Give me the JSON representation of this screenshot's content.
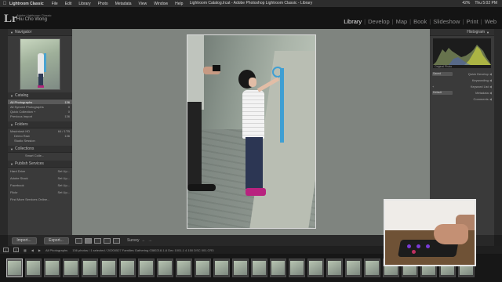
{
  "menubar": {
    "app_name": "Lightroom Classic",
    "menus": [
      "File",
      "Edit",
      "Library",
      "Photo",
      "Metadata",
      "View",
      "Window",
      "Help"
    ],
    "window_title": "Lightroom Catalog.lrcat - Adobe Photoshop Lightroom Classic - Library",
    "battery": "42%",
    "clock": "Thu 5:02 PM"
  },
  "header": {
    "logo": "Lr",
    "brand": "Adobe Lightroom Classic",
    "user": "Hiu Cho Wong",
    "modules": [
      "Library",
      "Develop",
      "Map",
      "Book",
      "Slideshow",
      "Print",
      "Web"
    ],
    "active_module": "Library"
  },
  "left_panel": {
    "navigator_label": "Navigator",
    "catalog_label": "Catalog",
    "catalog_items": [
      {
        "label": "All Photographs",
        "count": "136"
      },
      {
        "label": "All Synced Photographs",
        "count": "0"
      },
      {
        "label": "Quick Collection +",
        "count": "0"
      },
      {
        "label": "Previous Import",
        "count": "136"
      }
    ],
    "folders_label": "Folders",
    "folders": [
      {
        "label": "Macintosh HD",
        "count": "64 / 1TB"
      },
      {
        "label": "Demo Raw",
        "count": "136"
      },
      {
        "label": "Studio Session",
        "count": ""
      }
    ],
    "collections_label": "Collections",
    "collections": [
      {
        "label": "Smart Colle...",
        "count": ""
      }
    ],
    "publish_label": "Publish Services",
    "publish_items": [
      {
        "label": "Hard Drive",
        "count": "Set Up..."
      },
      {
        "label": "Adobe Stock",
        "count": "Set Up..."
      },
      {
        "label": "Facebook",
        "count": "Set Up..."
      },
      {
        "label": "Flickr",
        "count": "Set Up..."
      },
      {
        "label": "Find More Services Online...",
        "count": ""
      }
    ],
    "import_label": "Import...",
    "export_label": "Export..."
  },
  "right_panel": {
    "histogram_label": "Histogram",
    "original_photo": "Original Photo",
    "quick_develop_label": "Quick Develop",
    "quick_develop_select": "Saved",
    "keywording_label": "Keywording",
    "keyword_list_label": "Keyword List",
    "metadata_label": "Metadata",
    "metadata_select": "Default",
    "comments_label": "Comments"
  },
  "toolbar": {
    "survey_label": "Survey"
  },
  "filmstrip": {
    "page_1": "1",
    "page_2": "2",
    "source": "All Photographs",
    "selection_info": "136 photos / 1 selected / 20200527 Families Gathering 0380218-1-6 Dec 1001-1 4 150 DSC 001.CR3"
  },
  "colors": {
    "active_module": "#eaeaea",
    "inactive_module": "#8e8e8e",
    "panel_bg": "#3a3a3a",
    "center_bg": "#7f847f",
    "selection_bg": "#5a5a5a"
  }
}
